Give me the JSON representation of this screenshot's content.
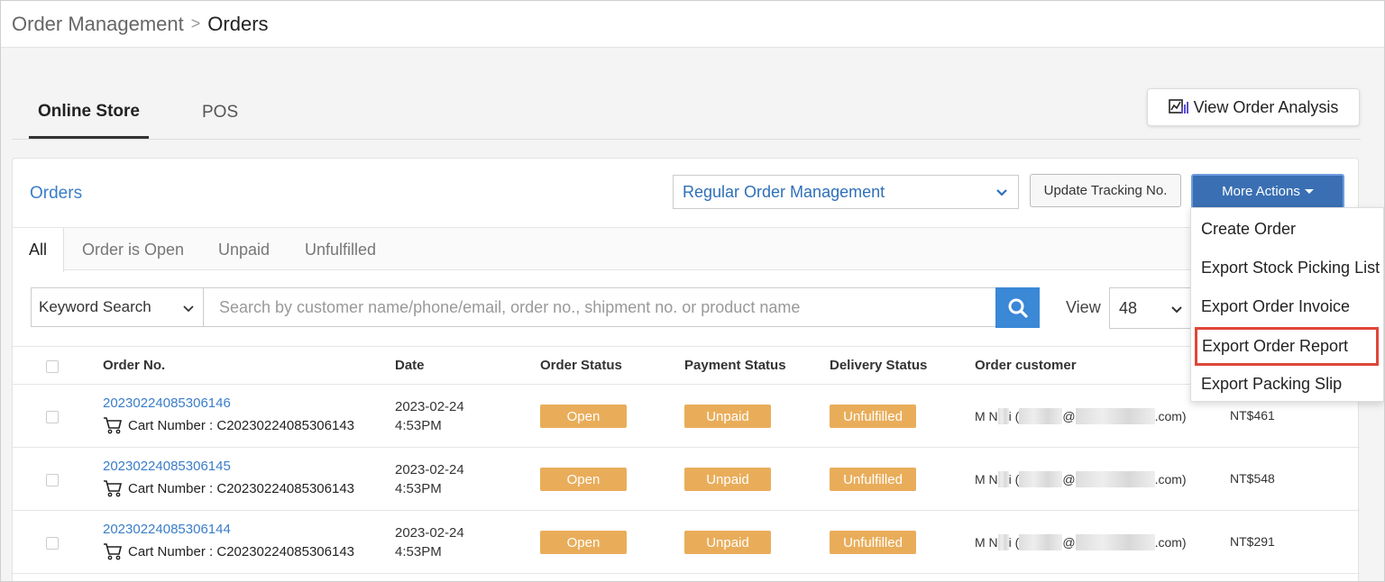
{
  "breadcrumb": {
    "parent": "Order Management",
    "separator": ">",
    "current": "Orders"
  },
  "channel_tabs": [
    {
      "label": "Online Store",
      "active": true
    },
    {
      "label": "POS",
      "active": false
    }
  ],
  "analysis_button": {
    "label": "View Order Analysis",
    "icon": "chart-analysis-icon"
  },
  "panel": {
    "title": "Orders",
    "management_select": {
      "value": "Regular Order Management"
    },
    "update_tracking_label": "Update Tracking No.",
    "more_actions_label": "More Actions"
  },
  "status_tabs": [
    {
      "label": "All",
      "active": true
    },
    {
      "label": "Order is Open",
      "active": false
    },
    {
      "label": "Unpaid",
      "active": false
    },
    {
      "label": "Unfulfilled",
      "active": false
    }
  ],
  "search": {
    "type_value": "Keyword Search",
    "placeholder": "Search by customer name/phone/email, order no., shipment no. or product name",
    "view_label": "View",
    "view_value": "48"
  },
  "table": {
    "headers": [
      "Order No.",
      "Date",
      "Order Status",
      "Payment Status",
      "Delivery Status",
      "Order customer"
    ],
    "rows": [
      {
        "order_no": "20230224085306146",
        "cart": "Cart Number : C20230224085306143",
        "date": "2023-02-24",
        "time": "4:53PM",
        "order_status": "Open",
        "payment_status": "Unpaid",
        "delivery_status": "Unfulfilled",
        "customer_prefix": "M N",
        "customer_mid": "i (",
        "customer_at": "@",
        "customer_suffix": ".com)",
        "amount": "NT$461"
      },
      {
        "order_no": "20230224085306145",
        "cart": "Cart Number : C20230224085306143",
        "date": "2023-02-24",
        "time": "4:53PM",
        "order_status": "Open",
        "payment_status": "Unpaid",
        "delivery_status": "Unfulfilled",
        "customer_prefix": "M N",
        "customer_mid": "i (",
        "customer_at": "@",
        "customer_suffix": ".com)",
        "amount": "NT$548"
      },
      {
        "order_no": "20230224085306144",
        "cart": "Cart Number : C20230224085306143",
        "date": "2023-02-24",
        "time": "4:53PM",
        "order_status": "Open",
        "payment_status": "Unpaid",
        "delivery_status": "Unfulfilled",
        "customer_prefix": "M N",
        "customer_mid": "i (",
        "customer_at": "@",
        "customer_suffix": ".com)",
        "amount": "NT$291"
      }
    ]
  },
  "more_actions_menu": [
    {
      "label": "Create Order",
      "highlighted": false
    },
    {
      "label": "Export Stock Picking List",
      "highlighted": false
    },
    {
      "label": "Export Order Invoice",
      "highlighted": false
    },
    {
      "label": "Export Order Report",
      "highlighted": true
    },
    {
      "label": "Export Packing Slip",
      "highlighted": false
    }
  ],
  "colors": {
    "accent_blue": "#3a7dc9",
    "more_actions_bg": "#3a6fb3",
    "badge_orange": "#e9ad5a",
    "highlight_red": "#e0463a"
  }
}
